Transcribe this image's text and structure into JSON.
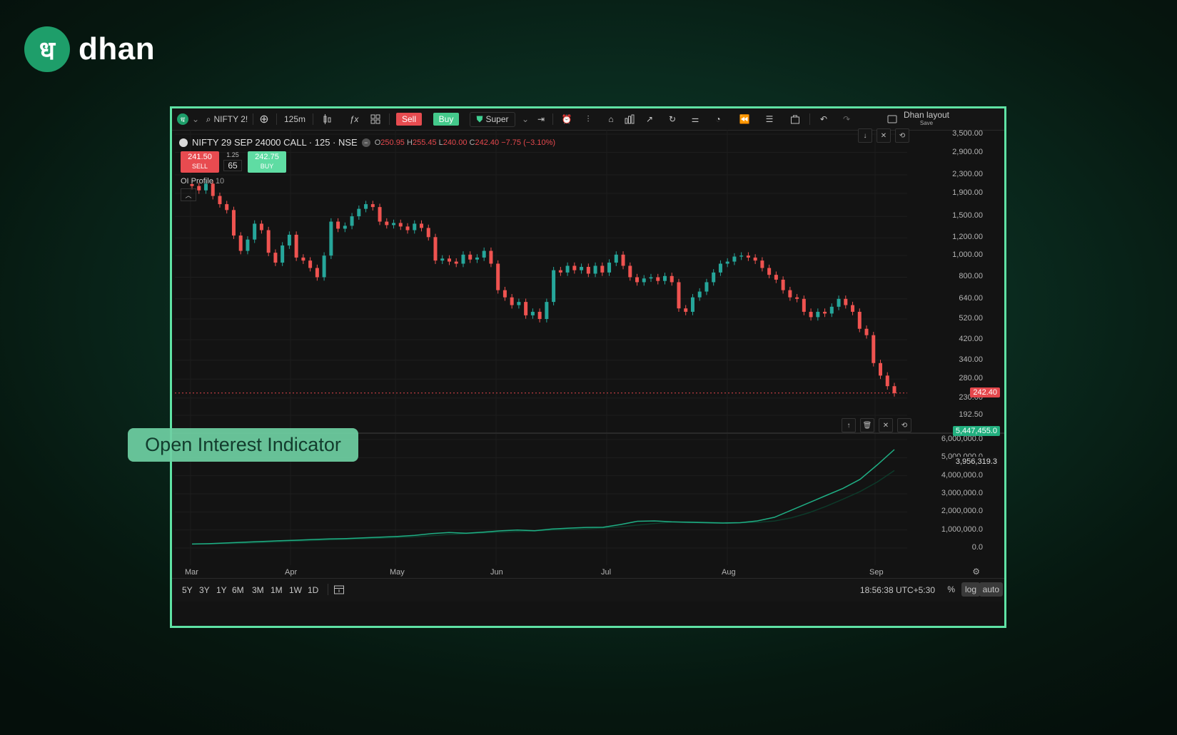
{
  "brand": {
    "mark": "ध",
    "name": "dhan"
  },
  "toolbar": {
    "symbol_search": "NIFTY 2!",
    "interval": "125m",
    "sell_label": "Sell",
    "buy_label": "Buy",
    "super_label": "Super",
    "layout_label": "Dhan layout",
    "layout_save": "Save"
  },
  "legend": {
    "symbol": "NIFTY 29 SEP 24000 CALL · 125 · NSE",
    "o_label": "O",
    "o_value": "250.95",
    "h_label": "H",
    "h_value": "255.45",
    "l_label": "L",
    "l_value": "240.00",
    "c_label": "C",
    "c_value": "242.40",
    "change": "−7.75 (−3.10%)"
  },
  "trade_chips": {
    "sell_price": "241.50",
    "sell_label": "SELL",
    "lot_size": "1.25",
    "quantity": "65",
    "buy_price": "242.75",
    "buy_label": "BUY"
  },
  "indicator": {
    "name": "OI Profile",
    "param": "10"
  },
  "price_axis": [
    "3,500.00",
    "2,900.00",
    "2,300.00",
    "1,900.00",
    "1,500.00",
    "1,200.00",
    "1,000.00",
    "800.00",
    "640.00",
    "520.00",
    "420.00",
    "340.00",
    "280.00",
    "230.00",
    "192.50"
  ],
  "last_price": "242.40",
  "oi_axis": [
    "6,000,000.0",
    "5,000,000.0",
    "4,000,000.0",
    "3,000,000.0",
    "2,000,000.0",
    "1,000,000.0",
    "0.0"
  ],
  "oi_last": "5,447,455.0",
  "oi_ma_value": "3,956,319.3",
  "months": [
    "Mar",
    "Apr",
    "May",
    "Jun",
    "Jul",
    "Aug",
    "Sep"
  ],
  "ranges": [
    "5Y",
    "3Y",
    "1Y",
    "6M",
    "3M",
    "1M",
    "1W",
    "1D"
  ],
  "clock": "18:56:38 UTC+5:30",
  "scale_flags": {
    "percent": "%",
    "log": "log",
    "auto": "auto"
  },
  "callout": "Open Interest Indicator",
  "colors": {
    "up": "#26a69a",
    "down": "#ef5350",
    "oi_line": "#1fae84",
    "frame": "#5fe2a4"
  },
  "chart_data": {
    "type": "candlestick",
    "yscale": "log",
    "closes": [
      2050,
      1960,
      2100,
      1850,
      1700,
      1600,
      1230,
      1050,
      1180,
      1390,
      1300,
      1030,
      930,
      1110,
      1240,
      980,
      950,
      880,
      800,
      1000,
      1420,
      1320,
      1360,
      1500,
      1620,
      1700,
      1650,
      1420,
      1370,
      1400,
      1350,
      1300,
      1390,
      1330,
      1210,
      950,
      970,
      940,
      920,
      1010,
      960,
      980,
      1050,
      920,
      700,
      650,
      600,
      620,
      540,
      560,
      520,
      620,
      860,
      840,
      900,
      860,
      890,
      830,
      900,
      840,
      930,
      1010,
      900,
      800,
      760,
      790,
      800,
      770,
      810,
      760,
      580,
      560,
      650,
      690,
      760,
      840,
      920,
      940,
      990,
      1000,
      980,
      950,
      880,
      820,
      780,
      700,
      650,
      640,
      560,
      530,
      560,
      550,
      590,
      640,
      600,
      560,
      470,
      440,
      330,
      290,
      260,
      242
    ],
    "oi_series": [
      220000,
      240000,
      280000,
      320000,
      360000,
      400000,
      430000,
      470000,
      500000,
      520000,
      560000,
      600000,
      640000,
      700000,
      800000,
      860000,
      820000,
      880000,
      950000,
      1000000,
      960000,
      1050000,
      1100000,
      1140000,
      1150000,
      1300000,
      1480000,
      1500000,
      1450000,
      1420000,
      1400000,
      1380000,
      1400000,
      1500000,
      1700000,
      2100000,
      2500000,
      2900000,
      3300000,
      3800000,
      4600000,
      5447455
    ],
    "ylim_price": [
      192.5,
      3500
    ],
    "ylim_oi": [
      0,
      6000000
    ]
  }
}
